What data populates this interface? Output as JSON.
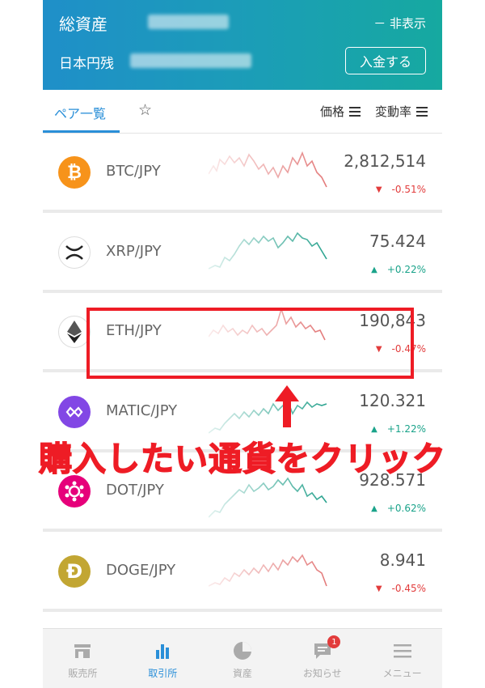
{
  "header": {
    "title": "総資産",
    "hide_toggle": "－ 非表示",
    "jpy_balance_label": "日本円残",
    "deposit_button": "入金する"
  },
  "tabs": {
    "pairs": "ペア一覧",
    "favorite_icon": "☆",
    "sort_price": "価格",
    "sort_change": "変動率"
  },
  "rows": [
    {
      "pair": "BTC/JPY",
      "price": "2,812,514",
      "change": "-0.51%",
      "direction": "down",
      "icon": "bitcoin-icon",
      "color": "#f7931a"
    },
    {
      "pair": "XRP/JPY",
      "price": "75.424",
      "change": "+0.22%",
      "direction": "up",
      "icon": "xrp-icon",
      "color": "#ffffff"
    },
    {
      "pair": "ETH/JPY",
      "price": "190,843",
      "change": "-0.47%",
      "direction": "down",
      "icon": "ethereum-icon",
      "color": "#ffffff"
    },
    {
      "pair": "MATIC/JPY",
      "price": "120.321",
      "change": "+1.22%",
      "direction": "up",
      "icon": "polygon-icon",
      "color": "#8247e5"
    },
    {
      "pair": "DOT/JPY",
      "price": "928.571",
      "change": "+0.62%",
      "direction": "up",
      "icon": "polkadot-icon",
      "color": "#e6007a"
    },
    {
      "pair": "DOGE/JPY",
      "price": "8.941",
      "change": "-0.45%",
      "direction": "down",
      "icon": "dogecoin-icon",
      "color": "#c2a633"
    }
  ],
  "annotation": {
    "callout": "購入したい通貨をクリック"
  },
  "bottom_nav": [
    {
      "label": "販売所",
      "icon": "store-icon",
      "active": false
    },
    {
      "label": "取引所",
      "icon": "bar-chart-icon",
      "active": true
    },
    {
      "label": "資産",
      "icon": "pie-chart-icon",
      "active": false
    },
    {
      "label": "お知らせ",
      "icon": "message-icon",
      "active": false,
      "badge": "1"
    },
    {
      "label": "メニュー",
      "icon": "menu-icon",
      "active": false
    }
  ],
  "colors": {
    "accent": "#2a8fd8",
    "down": "#e23c3c",
    "up": "#1aa38a",
    "annotation_red": "#ee1c25"
  }
}
